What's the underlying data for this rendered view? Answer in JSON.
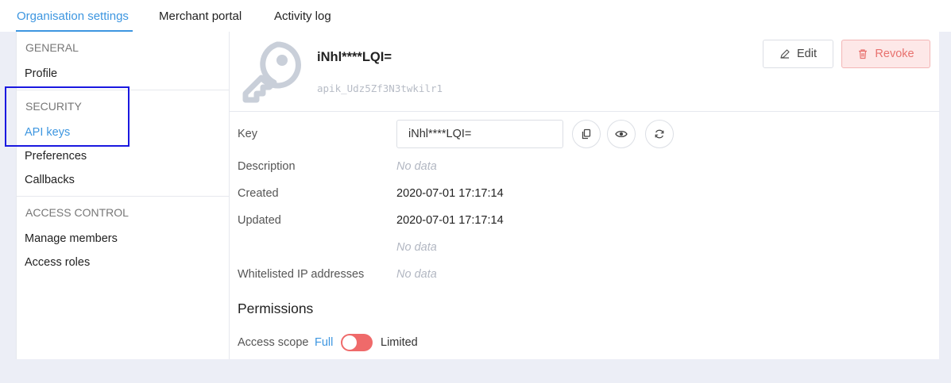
{
  "tabs": [
    {
      "label": "Organisation settings",
      "active": true
    },
    {
      "label": "Merchant portal",
      "active": false
    },
    {
      "label": "Activity log",
      "active": false
    }
  ],
  "sidebar": {
    "general_heading": "GENERAL",
    "profile": "Profile",
    "security_heading": "SECURITY",
    "api_keys": "API keys",
    "preferences": "Preferences",
    "callbacks": "Callbacks",
    "access_heading": "ACCESS CONTROL",
    "manage_members": "Manage members",
    "access_roles": "Access roles"
  },
  "key": {
    "title": "iNhl****LQI=",
    "id": "apik_Udz5Zf3N3twkilr1",
    "icon": "key-icon"
  },
  "actions": {
    "edit": "Edit",
    "revoke": "Revoke"
  },
  "details": {
    "key_label": "Key",
    "key_value": "iNhl****LQI=",
    "description_label": "Description",
    "description_value": "No data",
    "created_label": "Created",
    "created_value": "2020-07-01 17:17:14",
    "updated_label": "Updated",
    "updated_value": "2020-07-01 17:17:14",
    "extra_value": "No data",
    "whitelist_label": "Whitelisted IP addresses",
    "whitelist_value": "No data"
  },
  "permissions": {
    "title": "Permissions",
    "scope_label": "Access scope",
    "full": "Full",
    "limited": "Limited"
  },
  "colors": {
    "accent": "#3d96e0",
    "revoke": "#e8716e",
    "toggle": "#ef6a6a",
    "highlight": "#1a18e0"
  }
}
